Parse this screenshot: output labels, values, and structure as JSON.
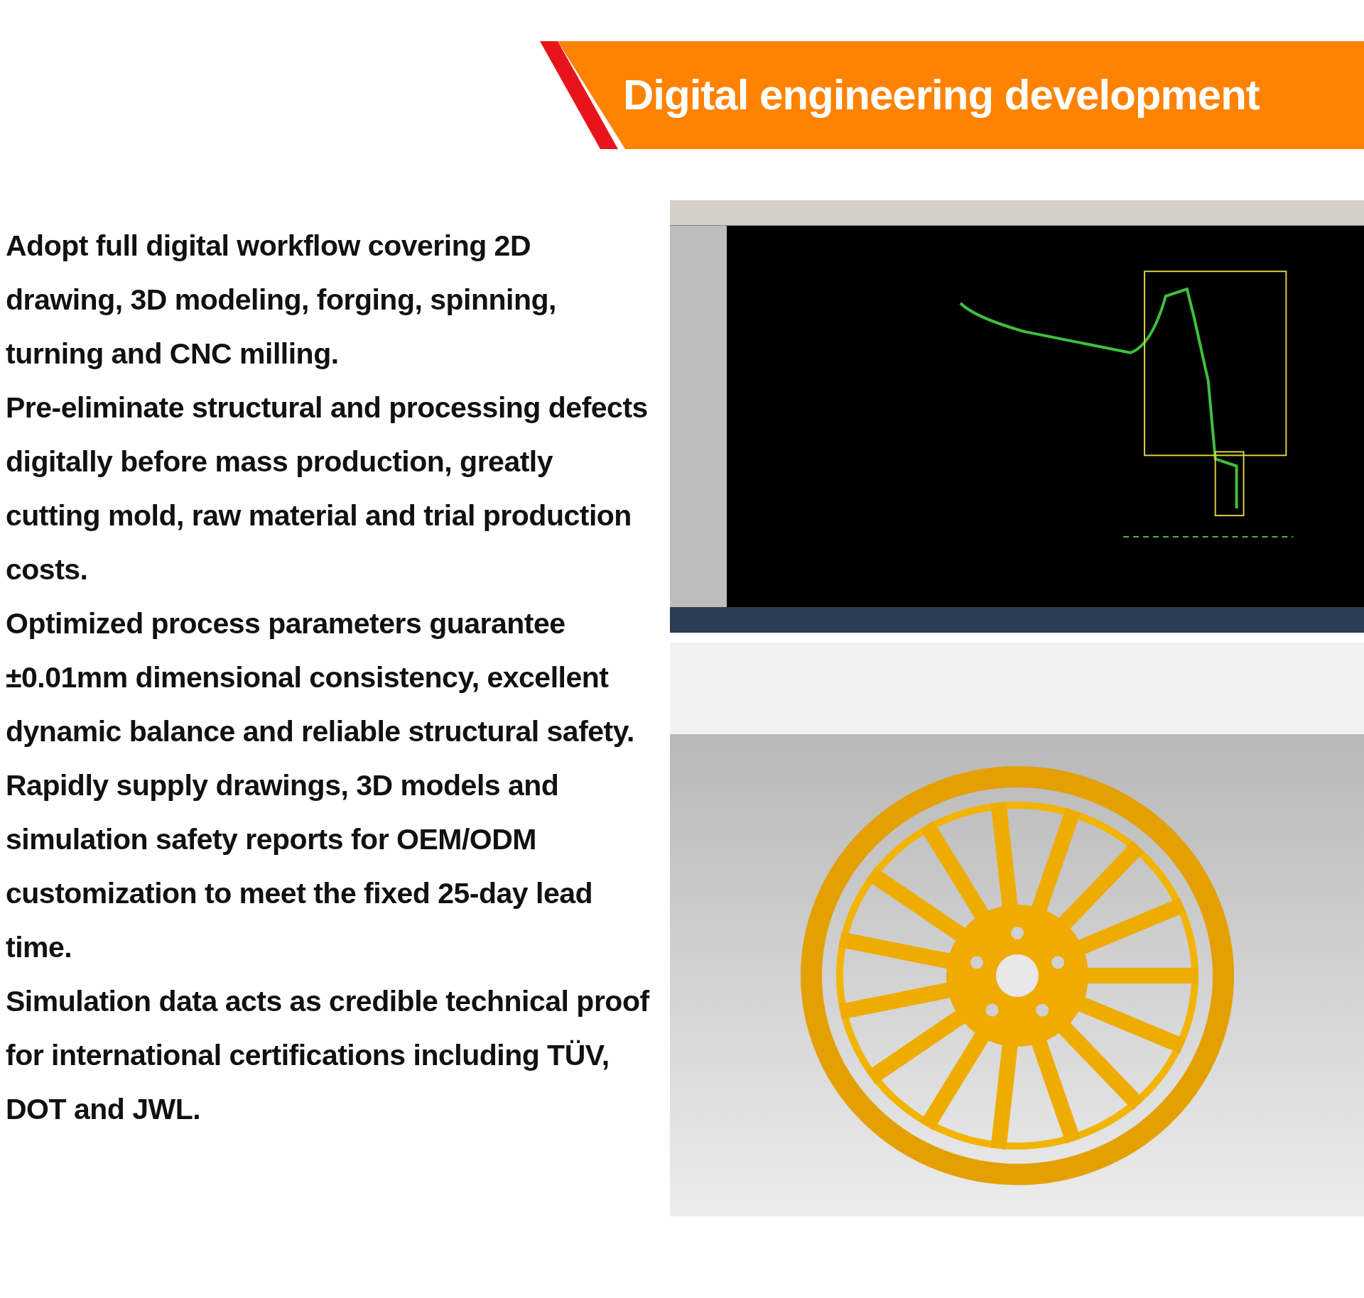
{
  "banner": {
    "title": "Digital engineering development"
  },
  "paragraphs": [
    "Adopt full digital workflow covering 2D drawing, 3D modeling, forging, spinning, turning and CNC milling.",
    "Pre-eliminate structural and processing defects digitally before mass production, greatly cutting mold, raw material and trial production costs.",
    "Optimized process parameters guarantee ±0.01mm dimensional consistency, excellent dynamic balance and reliable structural safety.",
    "Rapidly supply drawings, 3D models and simulation safety reports for OEM/ODM customization to meet the fixed 25-day lead time.",
    "Simulation data acts as credible technical proof for international certifications including TÜV, DOT and JWL."
  ]
}
